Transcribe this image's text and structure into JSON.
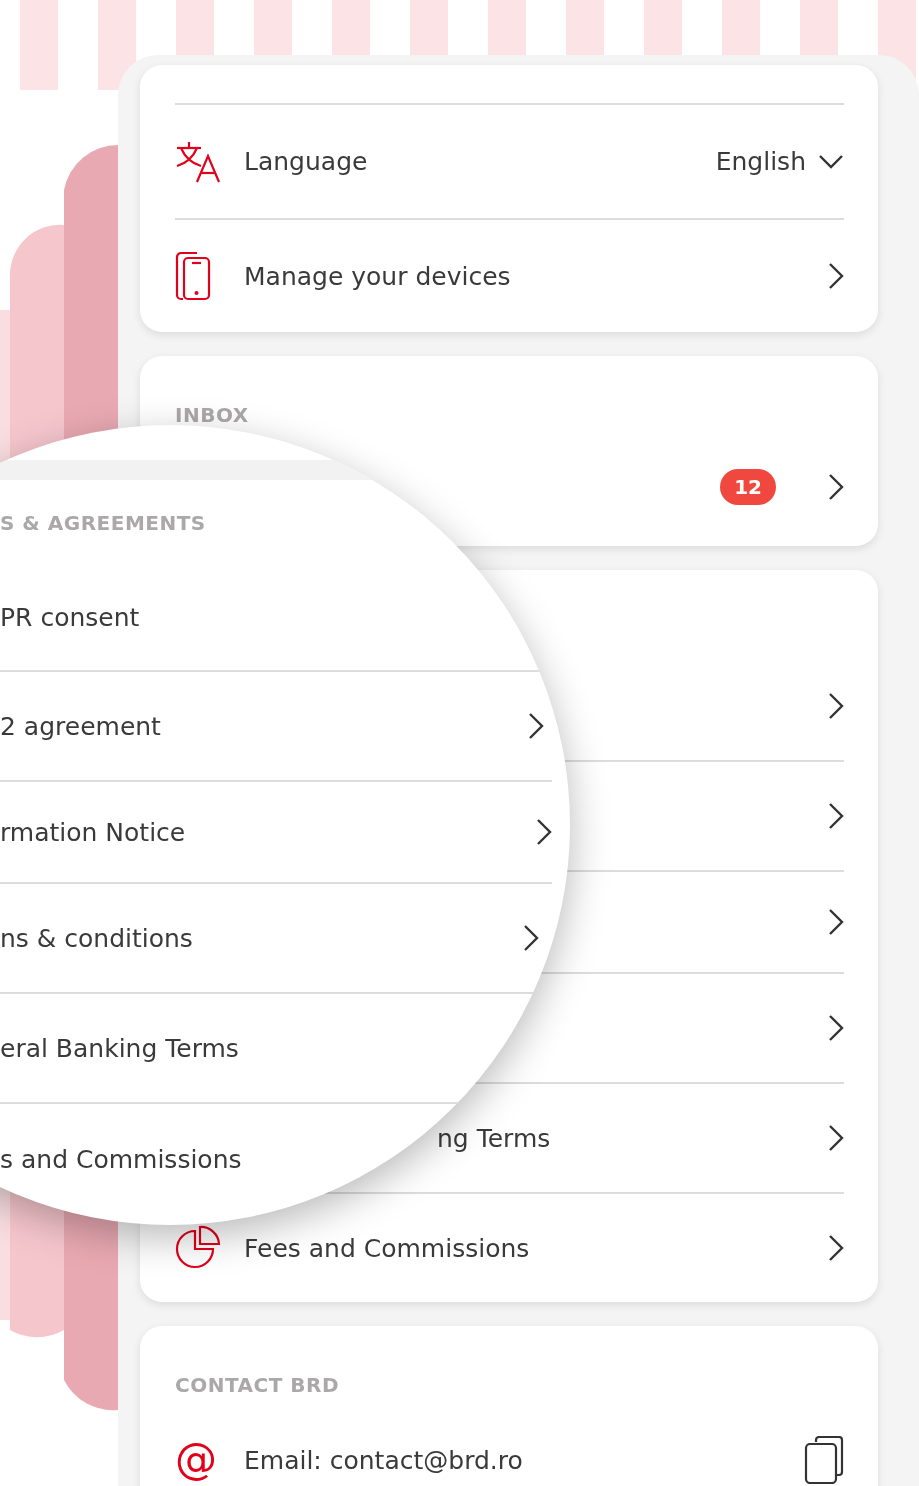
{
  "settings_card": {
    "rows": [
      {
        "kind": "language",
        "label": "Language",
        "value": "English"
      },
      {
        "kind": "devices",
        "label": "Manage your devices"
      }
    ]
  },
  "inbox_card": {
    "header": "INBOX",
    "rows": [
      {
        "kind": "badge",
        "badge": "12"
      }
    ]
  },
  "legal_card": {
    "rows": [
      {
        "kind": "link"
      },
      {
        "kind": "link"
      },
      {
        "kind": "link"
      },
      {
        "kind": "link"
      },
      {
        "kind": "partial",
        "label": "ng Terms"
      },
      {
        "kind": "fees",
        "label": "Fees and Commissions"
      }
    ]
  },
  "contact_card": {
    "header": "CONTACT BRD",
    "rows": [
      {
        "kind": "copy",
        "icon_text": "@",
        "label": "Email: contact@brd.ro"
      }
    ]
  },
  "magnifier": {
    "header": "S & AGREEMENTS",
    "rows": [
      {
        "label": "PR consent",
        "chevron": false
      },
      {
        "label": "2 agreement",
        "chevron": true
      },
      {
        "label": "rmation Notice",
        "chevron": true
      },
      {
        "label": "ns & conditions",
        "chevron": true
      },
      {
        "label": "eral Banking Terms",
        "chevron": false
      },
      {
        "label": "s and Commissions",
        "chevron": false
      }
    ]
  }
}
